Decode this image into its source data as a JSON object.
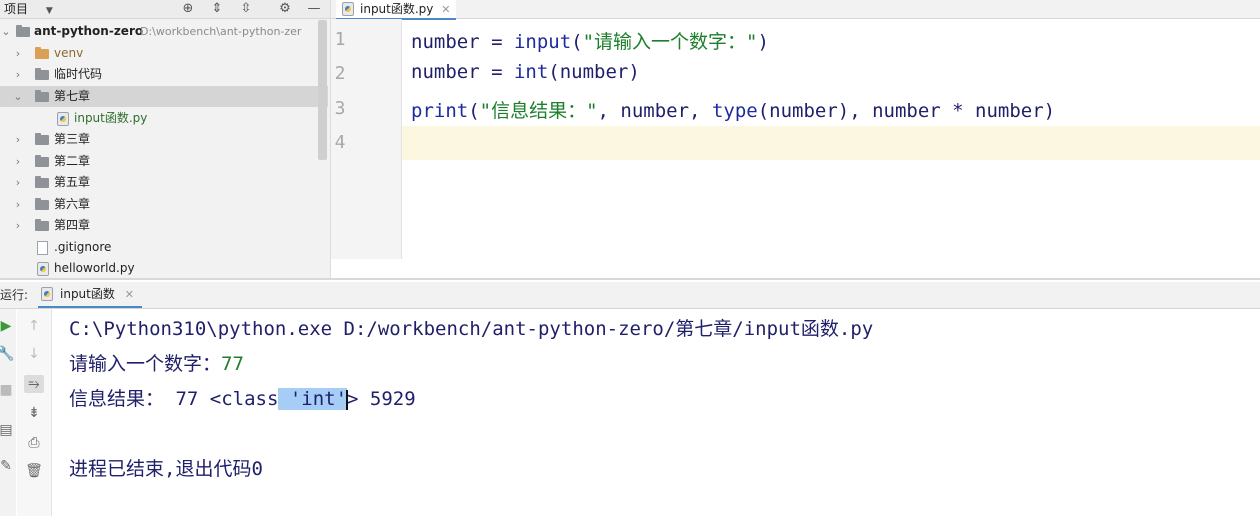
{
  "project": {
    "header_title": "项目",
    "root_name": "ant-python-zero",
    "root_path": "D:\\workbench\\ant-python-zer",
    "items": [
      {
        "label": "venv"
      },
      {
        "label": "临时代码"
      },
      {
        "label": "第七章"
      },
      {
        "label": "input函数.py"
      },
      {
        "label": "第三章"
      },
      {
        "label": "第二章"
      },
      {
        "label": "第五章"
      },
      {
        "label": "第六章"
      },
      {
        "label": "第四章"
      },
      {
        "label": ".gitignore"
      },
      {
        "label": "helloworld.py"
      }
    ]
  },
  "editor": {
    "tab_label": "input函数.py",
    "line_numbers": [
      "1",
      "2",
      "3",
      "4"
    ],
    "lines": {
      "l1": {
        "var": "number = ",
        "fn": "input",
        "open": "(",
        "str": "\"请输入一个数字：\"",
        "close": ")"
      },
      "l2": {
        "text": "number = ",
        "fn": "int",
        "rest": "(number)"
      },
      "l3": {
        "fn": "print",
        "open": "(",
        "str": "\"信息结果：\"",
        "mid": ", number, ",
        "fn2": "type",
        "rest": "(number), number * number)"
      }
    }
  },
  "run": {
    "label": "运行:",
    "tab_label": "input函数",
    "console": {
      "command": "C:\\Python310\\python.exe D:/workbench/ant-python-zero/第七章/input函数.py",
      "prompt": "请输入一个数字：",
      "user_input": "77",
      "result_prefix": "信息结果： 77 <class",
      "result_selected": " 'int'",
      "result_suffix": "> 5929",
      "exit_message": "进程已结束,退出代码0"
    }
  },
  "colors": {
    "accent": "#4a88c7",
    "string_green": "#1d7f2c",
    "keyword_blue": "#1c2c9e",
    "selection": "#a6cdf5"
  }
}
